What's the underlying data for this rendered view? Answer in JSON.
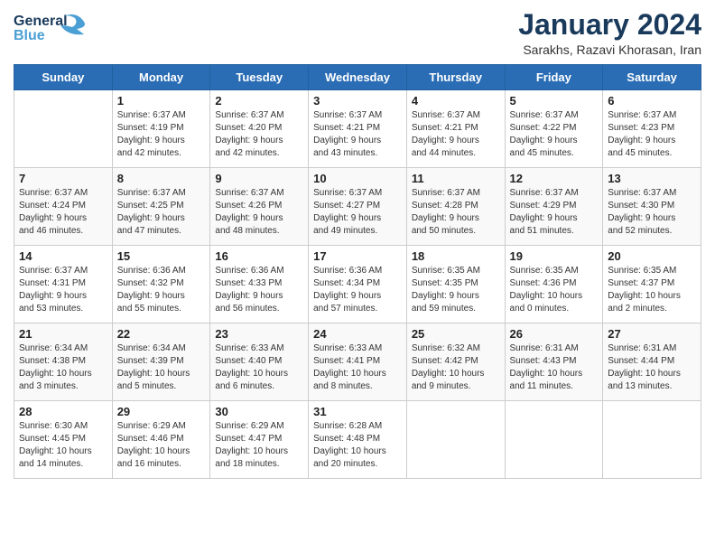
{
  "header": {
    "logo_line1": "General",
    "logo_line2": "Blue",
    "month_title": "January 2024",
    "subtitle": "Sarakhs, Razavi Khorasan, Iran"
  },
  "days_of_week": [
    "Sunday",
    "Monday",
    "Tuesday",
    "Wednesday",
    "Thursday",
    "Friday",
    "Saturday"
  ],
  "weeks": [
    [
      {
        "day": "",
        "sunrise": "",
        "sunset": "",
        "daylight": ""
      },
      {
        "day": "1",
        "sunrise": "Sunrise: 6:37 AM",
        "sunset": "Sunset: 4:19 PM",
        "daylight": "Daylight: 9 hours and 42 minutes."
      },
      {
        "day": "2",
        "sunrise": "Sunrise: 6:37 AM",
        "sunset": "Sunset: 4:20 PM",
        "daylight": "Daylight: 9 hours and 42 minutes."
      },
      {
        "day": "3",
        "sunrise": "Sunrise: 6:37 AM",
        "sunset": "Sunset: 4:21 PM",
        "daylight": "Daylight: 9 hours and 43 minutes."
      },
      {
        "day": "4",
        "sunrise": "Sunrise: 6:37 AM",
        "sunset": "Sunset: 4:21 PM",
        "daylight": "Daylight: 9 hours and 44 minutes."
      },
      {
        "day": "5",
        "sunrise": "Sunrise: 6:37 AM",
        "sunset": "Sunset: 4:22 PM",
        "daylight": "Daylight: 9 hours and 45 minutes."
      },
      {
        "day": "6",
        "sunrise": "Sunrise: 6:37 AM",
        "sunset": "Sunset: 4:23 PM",
        "daylight": "Daylight: 9 hours and 45 minutes."
      }
    ],
    [
      {
        "day": "7",
        "sunrise": "Sunrise: 6:37 AM",
        "sunset": "Sunset: 4:24 PM",
        "daylight": "Daylight: 9 hours and 46 minutes."
      },
      {
        "day": "8",
        "sunrise": "Sunrise: 6:37 AM",
        "sunset": "Sunset: 4:25 PM",
        "daylight": "Daylight: 9 hours and 47 minutes."
      },
      {
        "day": "9",
        "sunrise": "Sunrise: 6:37 AM",
        "sunset": "Sunset: 4:26 PM",
        "daylight": "Daylight: 9 hours and 48 minutes."
      },
      {
        "day": "10",
        "sunrise": "Sunrise: 6:37 AM",
        "sunset": "Sunset: 4:27 PM",
        "daylight": "Daylight: 9 hours and 49 minutes."
      },
      {
        "day": "11",
        "sunrise": "Sunrise: 6:37 AM",
        "sunset": "Sunset: 4:28 PM",
        "daylight": "Daylight: 9 hours and 50 minutes."
      },
      {
        "day": "12",
        "sunrise": "Sunrise: 6:37 AM",
        "sunset": "Sunset: 4:29 PM",
        "daylight": "Daylight: 9 hours and 51 minutes."
      },
      {
        "day": "13",
        "sunrise": "Sunrise: 6:37 AM",
        "sunset": "Sunset: 4:30 PM",
        "daylight": "Daylight: 9 hours and 52 minutes."
      }
    ],
    [
      {
        "day": "14",
        "sunrise": "Sunrise: 6:37 AM",
        "sunset": "Sunset: 4:31 PM",
        "daylight": "Daylight: 9 hours and 53 minutes."
      },
      {
        "day": "15",
        "sunrise": "Sunrise: 6:36 AM",
        "sunset": "Sunset: 4:32 PM",
        "daylight": "Daylight: 9 hours and 55 minutes."
      },
      {
        "day": "16",
        "sunrise": "Sunrise: 6:36 AM",
        "sunset": "Sunset: 4:33 PM",
        "daylight": "Daylight: 9 hours and 56 minutes."
      },
      {
        "day": "17",
        "sunrise": "Sunrise: 6:36 AM",
        "sunset": "Sunset: 4:34 PM",
        "daylight": "Daylight: 9 hours and 57 minutes."
      },
      {
        "day": "18",
        "sunrise": "Sunrise: 6:35 AM",
        "sunset": "Sunset: 4:35 PM",
        "daylight": "Daylight: 9 hours and 59 minutes."
      },
      {
        "day": "19",
        "sunrise": "Sunrise: 6:35 AM",
        "sunset": "Sunset: 4:36 PM",
        "daylight": "Daylight: 10 hours and 0 minutes."
      },
      {
        "day": "20",
        "sunrise": "Sunrise: 6:35 AM",
        "sunset": "Sunset: 4:37 PM",
        "daylight": "Daylight: 10 hours and 2 minutes."
      }
    ],
    [
      {
        "day": "21",
        "sunrise": "Sunrise: 6:34 AM",
        "sunset": "Sunset: 4:38 PM",
        "daylight": "Daylight: 10 hours and 3 minutes."
      },
      {
        "day": "22",
        "sunrise": "Sunrise: 6:34 AM",
        "sunset": "Sunset: 4:39 PM",
        "daylight": "Daylight: 10 hours and 5 minutes."
      },
      {
        "day": "23",
        "sunrise": "Sunrise: 6:33 AM",
        "sunset": "Sunset: 4:40 PM",
        "daylight": "Daylight: 10 hours and 6 minutes."
      },
      {
        "day": "24",
        "sunrise": "Sunrise: 6:33 AM",
        "sunset": "Sunset: 4:41 PM",
        "daylight": "Daylight: 10 hours and 8 minutes."
      },
      {
        "day": "25",
        "sunrise": "Sunrise: 6:32 AM",
        "sunset": "Sunset: 4:42 PM",
        "daylight": "Daylight: 10 hours and 9 minutes."
      },
      {
        "day": "26",
        "sunrise": "Sunrise: 6:31 AM",
        "sunset": "Sunset: 4:43 PM",
        "daylight": "Daylight: 10 hours and 11 minutes."
      },
      {
        "day": "27",
        "sunrise": "Sunrise: 6:31 AM",
        "sunset": "Sunset: 4:44 PM",
        "daylight": "Daylight: 10 hours and 13 minutes."
      }
    ],
    [
      {
        "day": "28",
        "sunrise": "Sunrise: 6:30 AM",
        "sunset": "Sunset: 4:45 PM",
        "daylight": "Daylight: 10 hours and 14 minutes."
      },
      {
        "day": "29",
        "sunrise": "Sunrise: 6:29 AM",
        "sunset": "Sunset: 4:46 PM",
        "daylight": "Daylight: 10 hours and 16 minutes."
      },
      {
        "day": "30",
        "sunrise": "Sunrise: 6:29 AM",
        "sunset": "Sunset: 4:47 PM",
        "daylight": "Daylight: 10 hours and 18 minutes."
      },
      {
        "day": "31",
        "sunrise": "Sunrise: 6:28 AM",
        "sunset": "Sunset: 4:48 PM",
        "daylight": "Daylight: 10 hours and 20 minutes."
      },
      {
        "day": "",
        "sunrise": "",
        "sunset": "",
        "daylight": ""
      },
      {
        "day": "",
        "sunrise": "",
        "sunset": "",
        "daylight": ""
      },
      {
        "day": "",
        "sunrise": "",
        "sunset": "",
        "daylight": ""
      }
    ]
  ]
}
